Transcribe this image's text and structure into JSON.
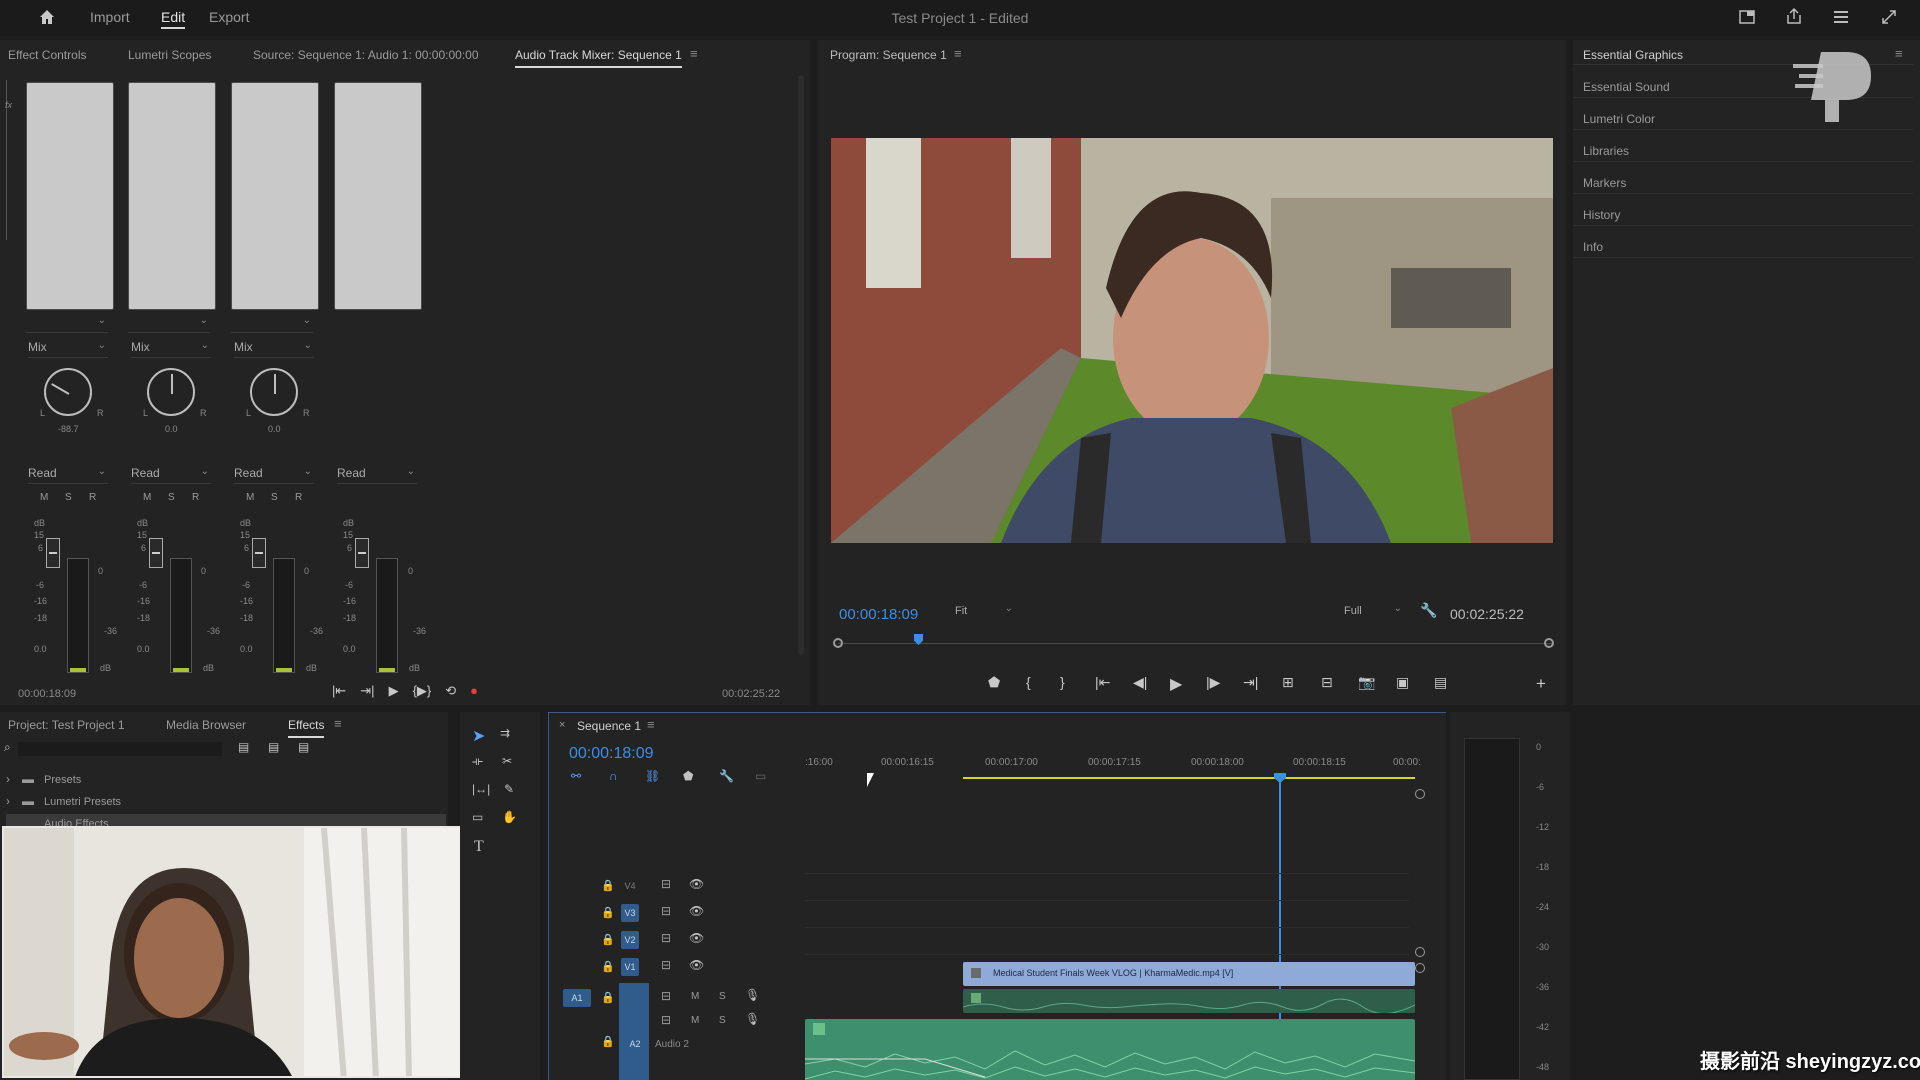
{
  "menubar": {
    "items": [
      "Import",
      "Edit",
      "Export"
    ],
    "active": "Edit",
    "title": "Test Project 1 - Edited"
  },
  "source_panel": {
    "tabs": [
      "Effect Controls",
      "Lumetri Scopes",
      "Source: Sequence 1: Audio 1: 00:00:00:00",
      "Audio Track Mixer: Sequence 1"
    ],
    "active_tab": "Audio Track Mixer: Sequence 1",
    "channels": [
      {
        "mode": "Mix",
        "pan": "-88.7",
        "auto": "Read",
        "db": "0.0"
      },
      {
        "mode": "Mix",
        "pan": "0.0",
        "auto": "Read",
        "db": "0.0"
      },
      {
        "mode": "Mix",
        "pan": "0.0",
        "auto": "Read",
        "db": "0.0"
      },
      {
        "mode": "",
        "pan": "",
        "auto": "Read",
        "db": "0.0"
      }
    ],
    "msr": [
      "M",
      "S",
      "R"
    ],
    "scale": [
      "dB",
      "15",
      "6",
      "0",
      "-6",
      "-16",
      "-36",
      "-18"
    ],
    "timecode_left": "00:00:18:09",
    "timecode_right": "00:02:25:22"
  },
  "program_panel": {
    "title": "Program: Sequence 1",
    "timecode": "00:00:18:09",
    "fit": "Fit",
    "quality": "Full",
    "duration": "00:02:25:22"
  },
  "right_panel": {
    "items": [
      "Essential Graphics",
      "Essential Sound",
      "Lumetri Color",
      "Libraries",
      "Markers",
      "History",
      "Info"
    ]
  },
  "project_panel": {
    "tabs": [
      "Project: Test Project 1",
      "Media Browser",
      "Effects"
    ],
    "active_tab": "Effects",
    "tree": [
      "Presets",
      "Lumetri Presets",
      "Audio Effects"
    ]
  },
  "timeline": {
    "tab": "Sequence 1",
    "timecode": "00:00:18:09",
    "ruler": [
      ":16:00",
      "00:00:16:15",
      "00:00:17:00",
      "00:00:17:15",
      "00:00:18:00",
      "00:00:18:15",
      "00:00:"
    ],
    "tracks": [
      "V4",
      "V3",
      "V2",
      "V1",
      "A1",
      "A2"
    ],
    "clip_video": "Medical Student Finals Week VLOG | KharmaMedic.mp4 [V]",
    "audio_track_name": "Audio 2",
    "track_buttons": {
      "a1_src": "A1",
      "a1_tgt": "A1",
      "a2_tgt": "A2"
    }
  },
  "meter_scale": [
    "0",
    "-6",
    "-12",
    "-18",
    "-24",
    "-30",
    "-36",
    "-42",
    "-48"
  ],
  "watermark": "摄影前沿 sheyingzyz.com",
  "colors": {
    "accent": "#3a8ee6",
    "clip_video": "#8fa9d8",
    "clip_audio": "#3e8f6d",
    "yellow_line": "#d6d62a"
  }
}
